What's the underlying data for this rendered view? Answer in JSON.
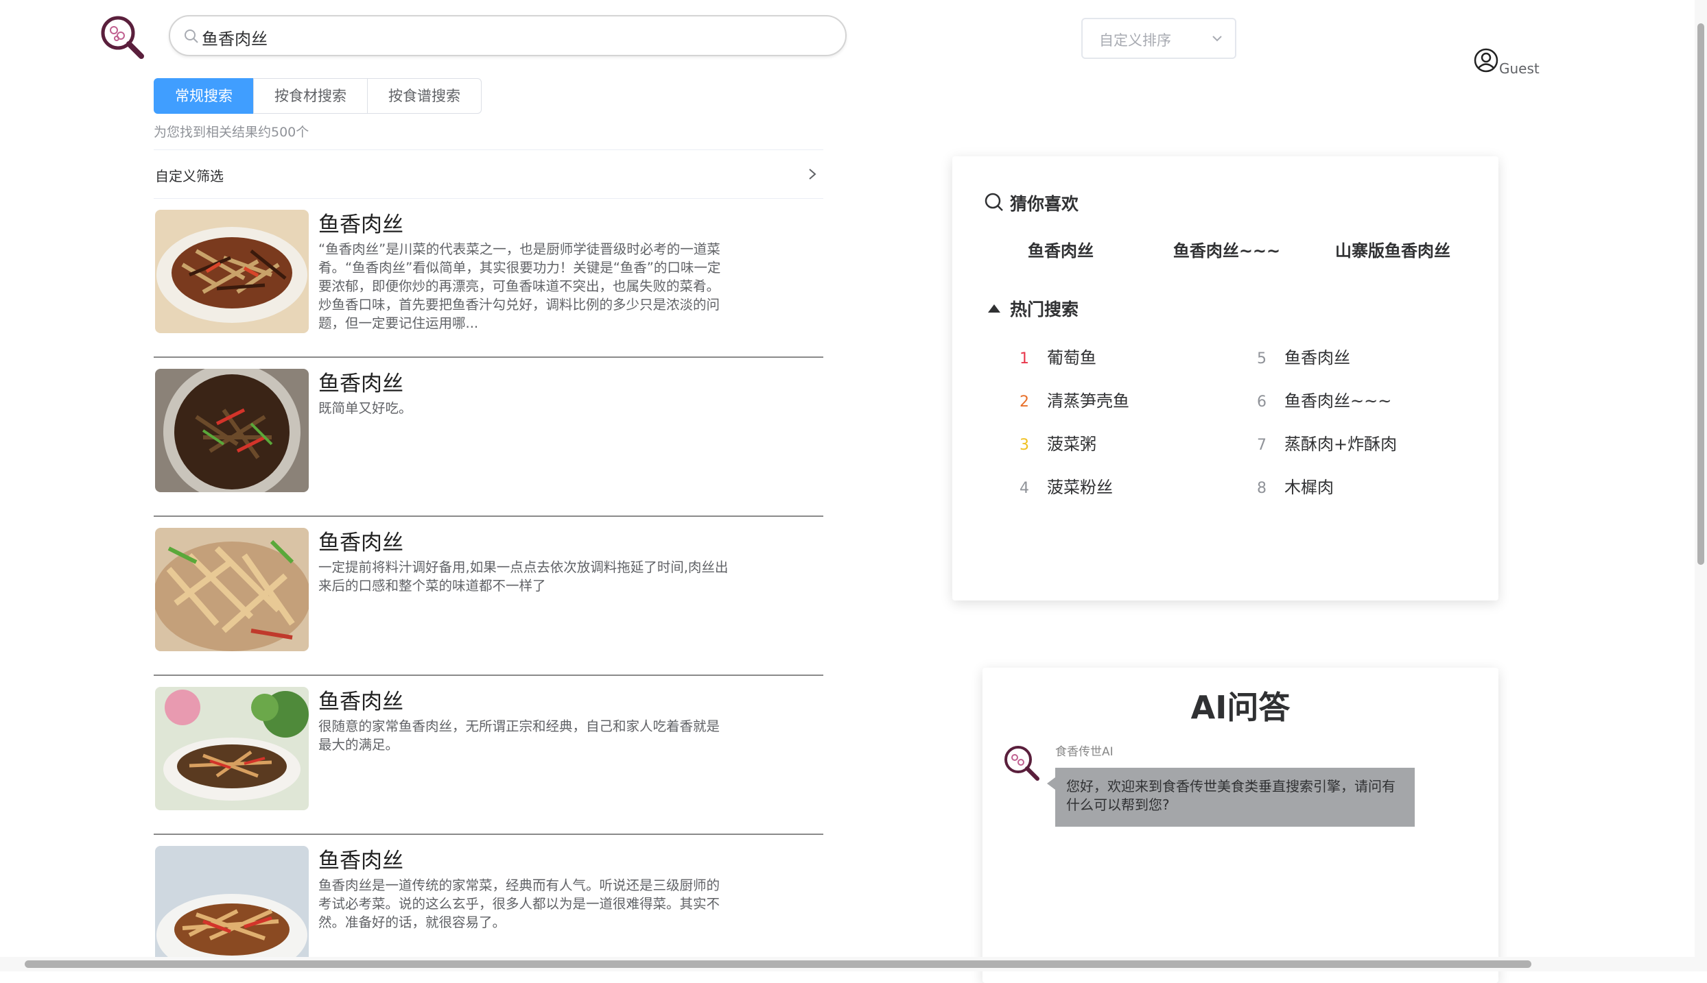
{
  "search": {
    "value": "鱼香肉丝"
  },
  "sort": {
    "placeholder": "自定义排序"
  },
  "user": {
    "name": "Guest"
  },
  "tabs": [
    {
      "label": "常规搜索",
      "active": true
    },
    {
      "label": "按食材搜索",
      "active": false
    },
    {
      "label": "按食谱搜索",
      "active": false
    }
  ],
  "result_count": "为您找到相关结果约500个",
  "filter": {
    "label": "自定义筛选"
  },
  "results": [
    {
      "title": "鱼香肉丝",
      "desc": "“鱼香肉丝”是川菜的代表菜之一，也是厨师学徒晋级时必考的一道菜肴。“鱼香肉丝”看似简单，其实很要功力！关键是“鱼香”的口味一定要浓郁，即便你炒的再漂亮，可鱼香味道不突出，也属失败的菜肴。 炒鱼香口味，首先要把鱼香汁勾兑好，调料比例的多少只是浓淡的问题，但一定要记住运用哪..."
    },
    {
      "title": "鱼香肉丝",
      "desc": "既简单又好吃。"
    },
    {
      "title": "鱼香肉丝",
      "desc": "一定提前将料汁调好备用,如果一点点去依次放调料拖延了时间,肉丝出来后的口感和整个菜的味道都不一样了"
    },
    {
      "title": "鱼香肉丝",
      "desc": "很随意的家常鱼香肉丝，无所谓正宗和经典，自己和家人吃着香就是最大的满足。"
    },
    {
      "title": "鱼香肉丝",
      "desc": "鱼香肉丝是一道传统的家常菜，经典而有人气。听说还是三级厨师的考试必考菜。说的这么玄乎，很多人都以为是一道很难得菜。其实不然。准备好的话，就很容易了。"
    }
  ],
  "guess": {
    "heading": "猜你喜欢",
    "items": [
      "鱼香肉丝",
      "鱼香肉丝~~~",
      "山寨版鱼香肉丝"
    ]
  },
  "hot": {
    "heading": "热门搜索",
    "items": [
      {
        "rank": "1",
        "label": "葡萄鱼",
        "color": "#e8364b"
      },
      {
        "rank": "2",
        "label": "清蒸笋壳鱼",
        "color": "#e8702a"
      },
      {
        "rank": "3",
        "label": "菠菜粥",
        "color": "#f0c020"
      },
      {
        "rank": "4",
        "label": "菠菜粉丝",
        "color": "#909399"
      },
      {
        "rank": "5",
        "label": "鱼香肉丝",
        "color": "#909399"
      },
      {
        "rank": "6",
        "label": "鱼香肉丝~~~",
        "color": "#909399"
      },
      {
        "rank": "7",
        "label": "蒸酥肉+炸酥肉",
        "color": "#909399"
      },
      {
        "rank": "8",
        "label": "木樨肉",
        "color": "#909399"
      }
    ]
  },
  "ai": {
    "title": "AI问答",
    "bot_name": "食香传世AI",
    "message": "您好，欢迎来到食香传世美食类垂直搜索引擎，请问有什么可以帮到您?"
  },
  "colors": {
    "accent": "#409eff",
    "logo": "#5a1f3c"
  }
}
